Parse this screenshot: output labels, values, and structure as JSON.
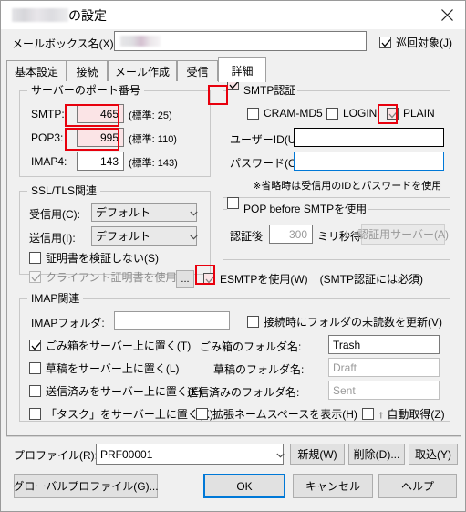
{
  "window": {
    "title_suffix": "の設定",
    "title_redacted": true,
    "close_label": "×"
  },
  "mailbox": {
    "label": "メールボックス名(X):",
    "value": "",
    "value_redacted": true,
    "patrol_checkbox": {
      "label": "巡回対象(J)",
      "checked": true
    }
  },
  "tabs": [
    {
      "label": "基本設定",
      "selected": false
    },
    {
      "label": "接続",
      "selected": false
    },
    {
      "label": "メール作成",
      "selected": false
    },
    {
      "label": "受信",
      "selected": false
    },
    {
      "label": "詳細",
      "selected": true
    }
  ],
  "server_ports": {
    "legend": "サーバーのポート番号",
    "rows": [
      {
        "label": "SMTP:",
        "value": "465",
        "default_note": "(標準: 25)",
        "highlighted": true
      },
      {
        "label": "POP3:",
        "value": "995",
        "default_note": "(標準: 110)",
        "highlighted": true
      },
      {
        "label": "IMAP4:",
        "value": "143",
        "default_note": "(標準: 143)",
        "highlighted": false
      }
    ]
  },
  "smtp_auth": {
    "legend": "SMTP認証",
    "enabled": true,
    "highlighted": true,
    "methods": [
      {
        "label": "CRAM-MD5",
        "checked": false,
        "highlighted": false
      },
      {
        "label": "LOGIN",
        "checked": false,
        "highlighted": false
      },
      {
        "label": "PLAIN",
        "checked": true,
        "highlighted": true
      }
    ],
    "user_id": {
      "label": "ユーザーID(U):",
      "value": ""
    },
    "password": {
      "label": "パスワード(O):",
      "value": ""
    },
    "note": "※省略時は受信用のIDとパスワードを使用"
  },
  "ssl_tls": {
    "legend": "SSL/TLS関連",
    "receive": {
      "label": "受信用(C):",
      "value": "デフォルト"
    },
    "send": {
      "label": "送信用(I):",
      "value": "デフォルト"
    },
    "no_verify": {
      "label": "証明書を検証しない(S)",
      "checked": false
    },
    "client_cert": {
      "label": "クライアント証明書を使用(F)",
      "checked": true,
      "disabled": true
    },
    "browse_button": "..."
  },
  "pop_before_smtp": {
    "legend": "POP before SMTPを使用",
    "enabled": false,
    "after_auth_label": "認証後",
    "wait_value": "300",
    "wait_unit": "ミリ秒待つ",
    "auth_server_button": "認証用サーバー(A)"
  },
  "esmtp": {
    "label": "ESMTPを使用(W)",
    "note": "(SMTP認証には必須)",
    "checked": true,
    "highlighted": true
  },
  "imap": {
    "legend": "IMAP関連",
    "folder": {
      "label": "IMAPフォルダ:",
      "value": ""
    },
    "update_unread": {
      "label": "接続時にフォルダの未読数を更新(V)",
      "checked": false
    },
    "rows": [
      {
        "checkbox": {
          "label": "ごみ箱をサーバー上に置く(T)",
          "checked": true
        },
        "name_label": "ごみ箱のフォルダ名:",
        "name_value": "Trash",
        "name_dim": false
      },
      {
        "checkbox": {
          "label": "草稿をサーバー上に置く(L)",
          "checked": false
        },
        "name_label": "草稿のフォルダ名:",
        "name_value": "Draft",
        "name_dim": true
      },
      {
        "checkbox": {
          "label": "送信済みをサーバー上に置く(E)",
          "checked": false
        },
        "name_label": "送信済みのフォルダ名:",
        "name_value": "Sent",
        "name_dim": true
      }
    ],
    "task_on_server": {
      "label": "「タスク」をサーバー上に置く(K)",
      "checked": false
    },
    "show_namespace": {
      "label": "拡張ネームスペースを表示(H)",
      "checked": false
    },
    "auto_get": {
      "label": "↑ 自動取得(Z)",
      "checked": false
    }
  },
  "profile": {
    "label": "プロファイル(R):",
    "value": "PRF00001",
    "buttons": [
      {
        "label": "新規(W)"
      },
      {
        "label": "削除(D)..."
      },
      {
        "label": "取込(Y)"
      }
    ]
  },
  "footer_buttons": {
    "global_profile": "グローバルプロファイル(G)...",
    "ok": "OK",
    "cancel": "キャンセル",
    "help": "ヘルプ"
  }
}
